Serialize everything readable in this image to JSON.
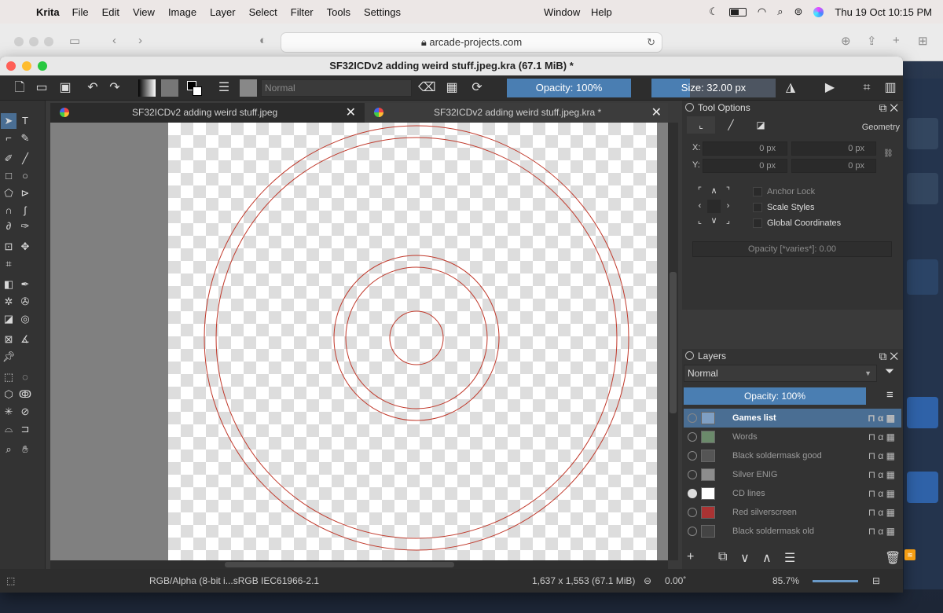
{
  "menubar": {
    "app": "Krita",
    "items": [
      "File",
      "Edit",
      "View",
      "Image",
      "Layer",
      "Select",
      "Filter",
      "Tools",
      "Settings"
    ],
    "center_items": [
      "Window",
      "Help"
    ],
    "clock": "Thu 19 Oct  10:15 PM"
  },
  "browser": {
    "url": "arcade-projects.com"
  },
  "window": {
    "title": "SF32ICDv2 adding weird stuff.jpeg.kra (67.1 MiB)  *"
  },
  "toolbar": {
    "blend_mode": "Normal",
    "opacity_label": "Opacity: 100%",
    "opacity_fraction": 1.0,
    "size_label": "Size: 32.00 px",
    "size_fill_fraction": 0.31
  },
  "tabs": [
    {
      "label": "SF32ICDv2 adding weird stuff.jpeg"
    },
    {
      "label": "SF32ICDv2 adding weird stuff.jpeg.kra *"
    }
  ],
  "tool_options": {
    "title": "Tool Options",
    "section": "Geometry",
    "x_label": "X:",
    "y_label": "Y:",
    "x_value": "0 px",
    "x_value2": "0 px",
    "y_value": "0 px",
    "y_value2": "0 px",
    "anchor_lock": "Anchor Lock",
    "scale_styles": "Scale Styles",
    "global_coordinates": "Global Coordinates",
    "opacity_field": "Opacity [*varies*]: 0.00"
  },
  "layers": {
    "title": "Layers",
    "blend_mode": "Normal",
    "opacity_label": "Opacity:  100%",
    "opacity_fraction": 1.0,
    "items": [
      {
        "name": "Games list",
        "selected": true,
        "visible": false
      },
      {
        "name": "Words",
        "selected": false,
        "visible": false
      },
      {
        "name": "Black soldermask good",
        "selected": false,
        "visible": false
      },
      {
        "name": "Silver ENIG",
        "selected": false,
        "visible": false
      },
      {
        "name": "CD lines",
        "selected": false,
        "visible": true
      },
      {
        "name": "Red silverscreen",
        "selected": false,
        "visible": false
      },
      {
        "name": "Black soldermask old",
        "selected": false,
        "visible": false
      }
    ]
  },
  "status": {
    "color_space": "RGB/Alpha (8-bit i...sRGB IEC61966-2.1",
    "dimensions": "1,637 x 1,553 (67.1 MiB)",
    "rotation": "0.00˚",
    "zoom": "85.7%"
  },
  "colors": {
    "accent": "#4a7eb2",
    "selected_layer": "#4a6e93",
    "cd_lines": "#c0392b"
  }
}
